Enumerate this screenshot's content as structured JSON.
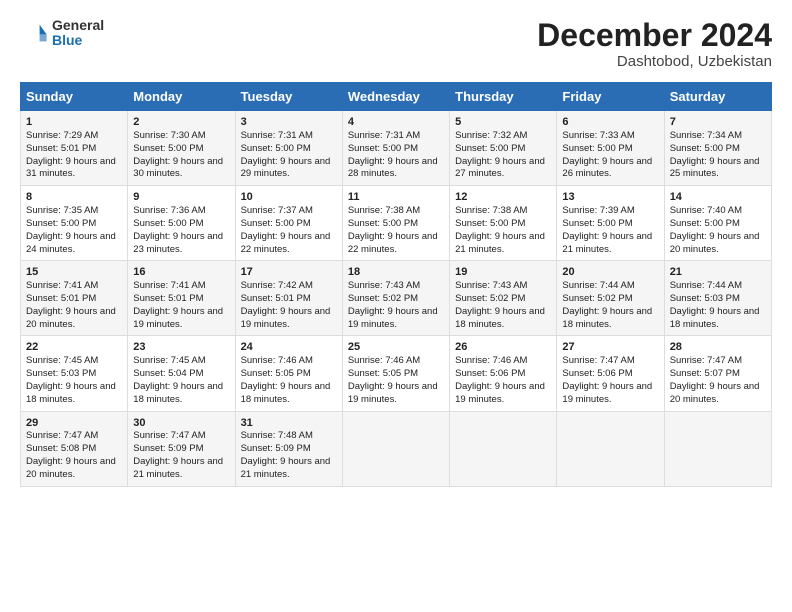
{
  "header": {
    "logo_general": "General",
    "logo_blue": "Blue",
    "month": "December 2024",
    "location": "Dashtobod, Uzbekistan"
  },
  "days_of_week": [
    "Sunday",
    "Monday",
    "Tuesday",
    "Wednesday",
    "Thursday",
    "Friday",
    "Saturday"
  ],
  "weeks": [
    [
      {
        "day": "1",
        "sunrise": "Sunrise: 7:29 AM",
        "sunset": "Sunset: 5:01 PM",
        "daylight": "Daylight: 9 hours and 31 minutes."
      },
      {
        "day": "2",
        "sunrise": "Sunrise: 7:30 AM",
        "sunset": "Sunset: 5:00 PM",
        "daylight": "Daylight: 9 hours and 30 minutes."
      },
      {
        "day": "3",
        "sunrise": "Sunrise: 7:31 AM",
        "sunset": "Sunset: 5:00 PM",
        "daylight": "Daylight: 9 hours and 29 minutes."
      },
      {
        "day": "4",
        "sunrise": "Sunrise: 7:31 AM",
        "sunset": "Sunset: 5:00 PM",
        "daylight": "Daylight: 9 hours and 28 minutes."
      },
      {
        "day": "5",
        "sunrise": "Sunrise: 7:32 AM",
        "sunset": "Sunset: 5:00 PM",
        "daylight": "Daylight: 9 hours and 27 minutes."
      },
      {
        "day": "6",
        "sunrise": "Sunrise: 7:33 AM",
        "sunset": "Sunset: 5:00 PM",
        "daylight": "Daylight: 9 hours and 26 minutes."
      },
      {
        "day": "7",
        "sunrise": "Sunrise: 7:34 AM",
        "sunset": "Sunset: 5:00 PM",
        "daylight": "Daylight: 9 hours and 25 minutes."
      }
    ],
    [
      {
        "day": "8",
        "sunrise": "Sunrise: 7:35 AM",
        "sunset": "Sunset: 5:00 PM",
        "daylight": "Daylight: 9 hours and 24 minutes."
      },
      {
        "day": "9",
        "sunrise": "Sunrise: 7:36 AM",
        "sunset": "Sunset: 5:00 PM",
        "daylight": "Daylight: 9 hours and 23 minutes."
      },
      {
        "day": "10",
        "sunrise": "Sunrise: 7:37 AM",
        "sunset": "Sunset: 5:00 PM",
        "daylight": "Daylight: 9 hours and 22 minutes."
      },
      {
        "day": "11",
        "sunrise": "Sunrise: 7:38 AM",
        "sunset": "Sunset: 5:00 PM",
        "daylight": "Daylight: 9 hours and 22 minutes."
      },
      {
        "day": "12",
        "sunrise": "Sunrise: 7:38 AM",
        "sunset": "Sunset: 5:00 PM",
        "daylight": "Daylight: 9 hours and 21 minutes."
      },
      {
        "day": "13",
        "sunrise": "Sunrise: 7:39 AM",
        "sunset": "Sunset: 5:00 PM",
        "daylight": "Daylight: 9 hours and 21 minutes."
      },
      {
        "day": "14",
        "sunrise": "Sunrise: 7:40 AM",
        "sunset": "Sunset: 5:00 PM",
        "daylight": "Daylight: 9 hours and 20 minutes."
      }
    ],
    [
      {
        "day": "15",
        "sunrise": "Sunrise: 7:41 AM",
        "sunset": "Sunset: 5:01 PM",
        "daylight": "Daylight: 9 hours and 20 minutes."
      },
      {
        "day": "16",
        "sunrise": "Sunrise: 7:41 AM",
        "sunset": "Sunset: 5:01 PM",
        "daylight": "Daylight: 9 hours and 19 minutes."
      },
      {
        "day": "17",
        "sunrise": "Sunrise: 7:42 AM",
        "sunset": "Sunset: 5:01 PM",
        "daylight": "Daylight: 9 hours and 19 minutes."
      },
      {
        "day": "18",
        "sunrise": "Sunrise: 7:43 AM",
        "sunset": "Sunset: 5:02 PM",
        "daylight": "Daylight: 9 hours and 19 minutes."
      },
      {
        "day": "19",
        "sunrise": "Sunrise: 7:43 AM",
        "sunset": "Sunset: 5:02 PM",
        "daylight": "Daylight: 9 hours and 18 minutes."
      },
      {
        "day": "20",
        "sunrise": "Sunrise: 7:44 AM",
        "sunset": "Sunset: 5:02 PM",
        "daylight": "Daylight: 9 hours and 18 minutes."
      },
      {
        "day": "21",
        "sunrise": "Sunrise: 7:44 AM",
        "sunset": "Sunset: 5:03 PM",
        "daylight": "Daylight: 9 hours and 18 minutes."
      }
    ],
    [
      {
        "day": "22",
        "sunrise": "Sunrise: 7:45 AM",
        "sunset": "Sunset: 5:03 PM",
        "daylight": "Daylight: 9 hours and 18 minutes."
      },
      {
        "day": "23",
        "sunrise": "Sunrise: 7:45 AM",
        "sunset": "Sunset: 5:04 PM",
        "daylight": "Daylight: 9 hours and 18 minutes."
      },
      {
        "day": "24",
        "sunrise": "Sunrise: 7:46 AM",
        "sunset": "Sunset: 5:05 PM",
        "daylight": "Daylight: 9 hours and 18 minutes."
      },
      {
        "day": "25",
        "sunrise": "Sunrise: 7:46 AM",
        "sunset": "Sunset: 5:05 PM",
        "daylight": "Daylight: 9 hours and 19 minutes."
      },
      {
        "day": "26",
        "sunrise": "Sunrise: 7:46 AM",
        "sunset": "Sunset: 5:06 PM",
        "daylight": "Daylight: 9 hours and 19 minutes."
      },
      {
        "day": "27",
        "sunrise": "Sunrise: 7:47 AM",
        "sunset": "Sunset: 5:06 PM",
        "daylight": "Daylight: 9 hours and 19 minutes."
      },
      {
        "day": "28",
        "sunrise": "Sunrise: 7:47 AM",
        "sunset": "Sunset: 5:07 PM",
        "daylight": "Daylight: 9 hours and 20 minutes."
      }
    ],
    [
      {
        "day": "29",
        "sunrise": "Sunrise: 7:47 AM",
        "sunset": "Sunset: 5:08 PM",
        "daylight": "Daylight: 9 hours and 20 minutes."
      },
      {
        "day": "30",
        "sunrise": "Sunrise: 7:47 AM",
        "sunset": "Sunset: 5:09 PM",
        "daylight": "Daylight: 9 hours and 21 minutes."
      },
      {
        "day": "31",
        "sunrise": "Sunrise: 7:48 AM",
        "sunset": "Sunset: 5:09 PM",
        "daylight": "Daylight: 9 hours and 21 minutes."
      },
      null,
      null,
      null,
      null
    ]
  ]
}
